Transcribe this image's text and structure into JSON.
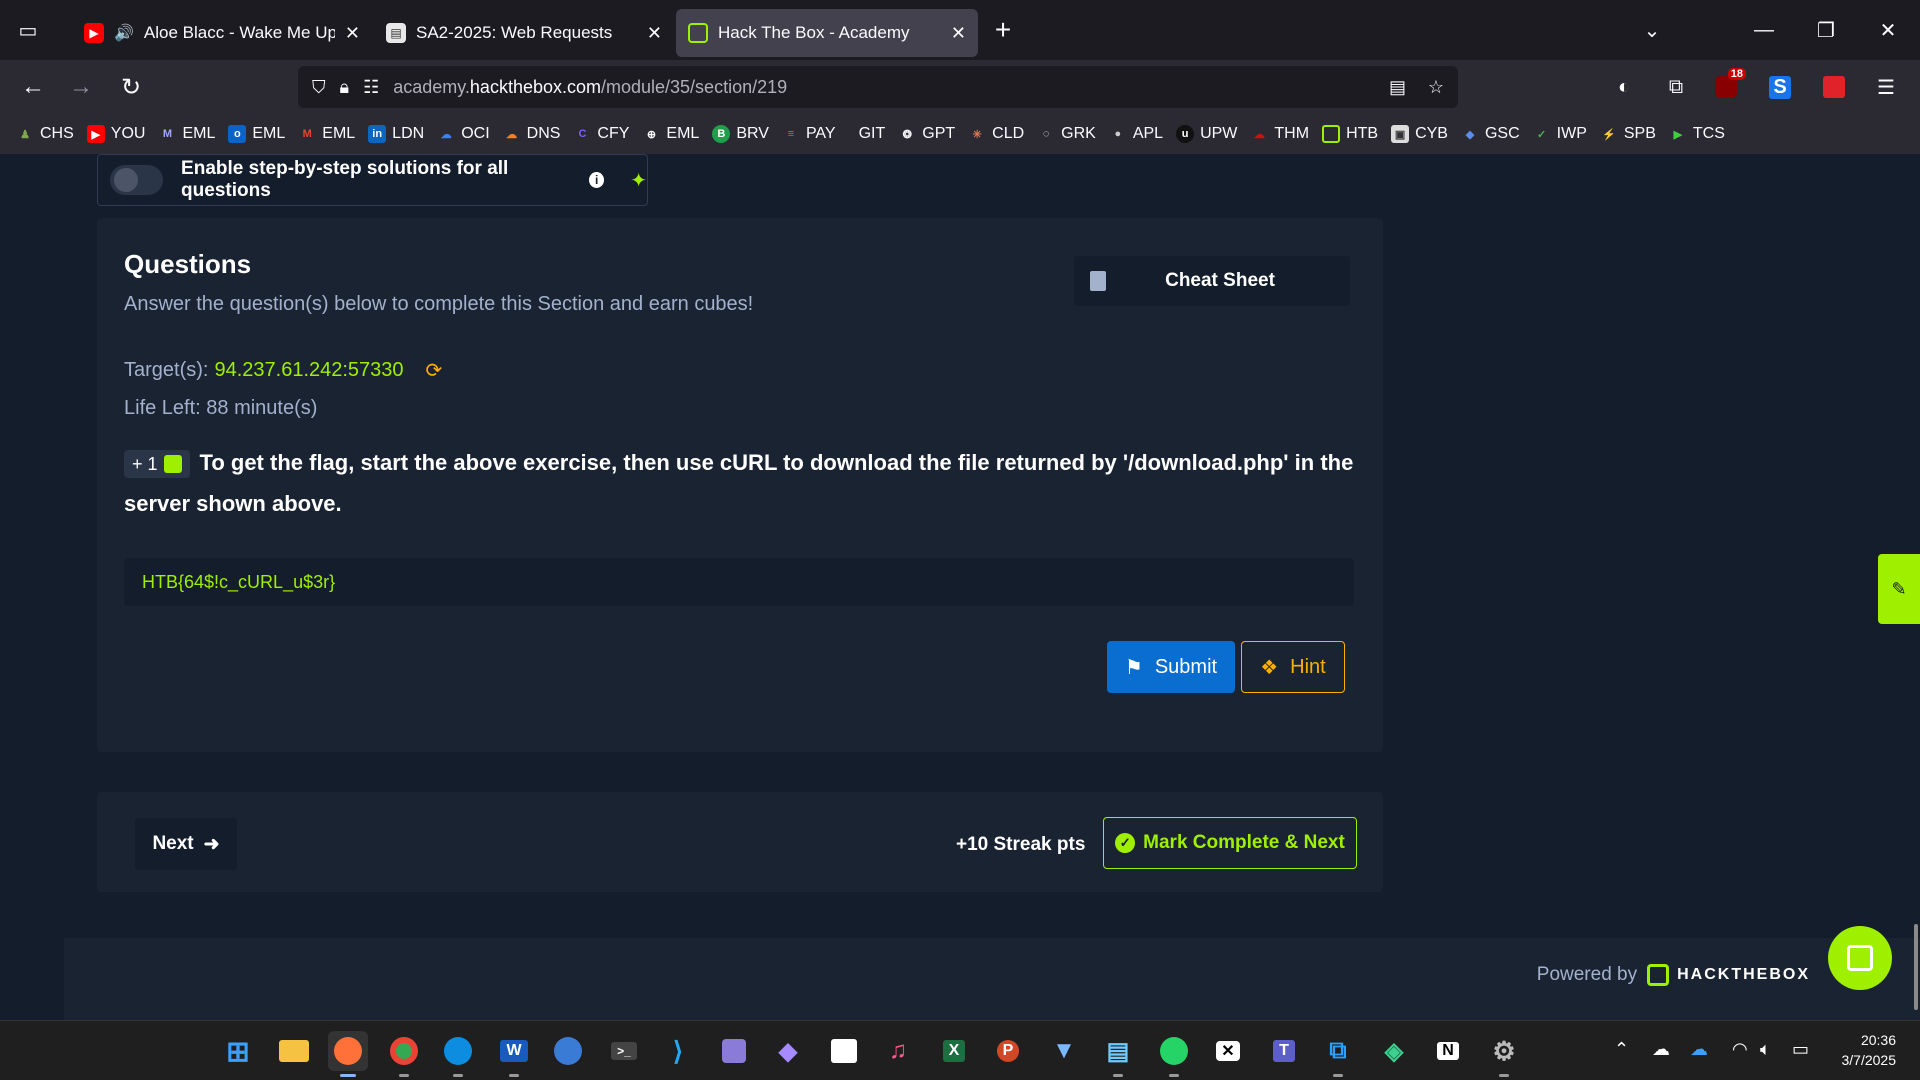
{
  "browser": {
    "tabs": [
      {
        "title": "Aloe Blacc - Wake Me Up (A",
        "favicon": "youtube-icon",
        "audio": true,
        "active": false
      },
      {
        "title": "SA2-2025: Web Requests",
        "favicon": "document-icon",
        "active": false
      },
      {
        "title": "Hack The Box - Academy",
        "favicon": "htb-cube-icon",
        "active": true
      }
    ],
    "url_prefix": "academy.",
    "url_domain": "hackthebox.com",
    "url_path": "/module/35/section/219",
    "extension_badge": "18"
  },
  "bookmarks": [
    "CHS",
    "YOU",
    "EML",
    "EML",
    "EML",
    "LDN",
    "OCI",
    "DNS",
    "CFY",
    "EML",
    "BRV",
    "PAY",
    "GIT",
    "GPT",
    "CLD",
    "GRK",
    "APL",
    "UPW",
    "THM",
    "HTB",
    "CYB",
    "GSC",
    "IWP",
    "SPB",
    "TCS"
  ],
  "page": {
    "toggle_label": "Enable step-by-step solutions for all questions",
    "questions_title": "Questions",
    "questions_subtitle": "Answer the question(s) below to complete this Section and earn cubes!",
    "cheat_sheet": "Cheat Sheet",
    "target_label": "Target(s):",
    "target_ip": "94.237.61.242:57330",
    "life_left": "Life Left: 88 minute(s)",
    "question_reward": "+ 1",
    "question_text": "To get the flag, start the above exercise, then use cURL to download the file returned by '/download.php' in the server shown above.",
    "answer_value": "HTB{64$!c_cURL_u$3r}",
    "submit_label": "Submit",
    "hint_label": "Hint",
    "next_label": "Next",
    "streak_label": "+10 Streak pts",
    "mark_complete_label": "Mark Complete & Next",
    "powered_by": "Powered by",
    "powered_brand": "HACKTHEBOX"
  },
  "taskbar": {
    "time": "20:36",
    "date": "3/7/2025"
  },
  "colors": {
    "accent_green": "#9fef00",
    "accent_orange": "#ffaf00",
    "submit_blue": "#0a6ed1",
    "page_bg": "#141d2b",
    "panel_bg": "#1a2332"
  }
}
